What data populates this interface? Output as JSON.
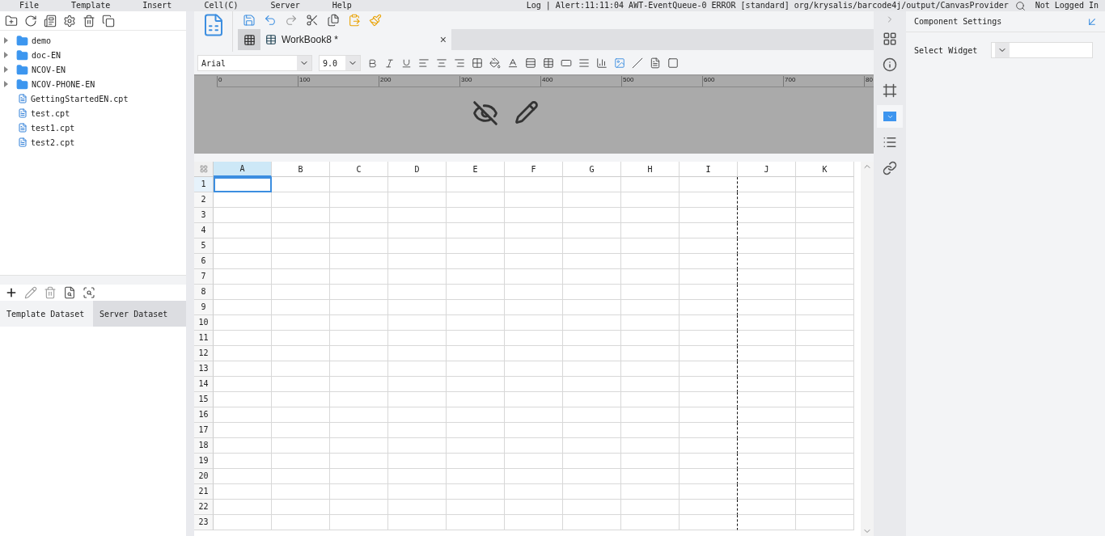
{
  "menu": [
    "File",
    "Template",
    "Insert",
    "Cell(C)",
    "Server",
    "Help"
  ],
  "status_bar": {
    "log": "Log | Alert:11:11:04 AWT-EventQueue-0 ERROR [standard] org/krysalis/barcode4j/output/CanvasProvider",
    "login": "Not Logged In"
  },
  "tree": [
    {
      "kind": "folder",
      "label": "demo"
    },
    {
      "kind": "folder",
      "label": "doc-EN"
    },
    {
      "kind": "folder",
      "label": "NCOV-EN"
    },
    {
      "kind": "folder",
      "label": "NCOV-PHONE-EN"
    },
    {
      "kind": "file",
      "label": "GettingStartedEN.cpt"
    },
    {
      "kind": "file",
      "label": "test.cpt"
    },
    {
      "kind": "file",
      "label": "test1.cpt"
    },
    {
      "kind": "file",
      "label": "test2.cpt"
    }
  ],
  "dataset_tabs": [
    {
      "label": "Template Dataset",
      "selected": true
    },
    {
      "label": "Server Dataset",
      "selected": false
    }
  ],
  "document_tab": {
    "title": "WorkBook8 *",
    "close": "×"
  },
  "format": {
    "font": "Arial",
    "size": "9.0"
  },
  "ruler": [
    "0",
    "100",
    "200",
    "300",
    "400",
    "500",
    "600",
    "700",
    "80"
  ],
  "columns": [
    {
      "label": "A",
      "selected": true,
      "page_break": false
    },
    {
      "label": "B",
      "selected": false,
      "page_break": false
    },
    {
      "label": "C",
      "selected": false,
      "page_break": false
    },
    {
      "label": "D",
      "selected": false,
      "page_break": false
    },
    {
      "label": "E",
      "selected": false,
      "page_break": false
    },
    {
      "label": "F",
      "selected": false,
      "page_break": false
    },
    {
      "label": "G",
      "selected": false,
      "page_break": false
    },
    {
      "label": "H",
      "selected": false,
      "page_break": false
    },
    {
      "label": "I",
      "selected": false,
      "page_break": true
    },
    {
      "label": "J",
      "selected": false,
      "page_break": false
    },
    {
      "label": "K",
      "selected": false,
      "page_break": false
    }
  ],
  "rows": [
    {
      "label": "1",
      "selected": true
    },
    {
      "label": "2",
      "selected": false
    },
    {
      "label": "3",
      "selected": false
    },
    {
      "label": "4",
      "selected": false
    },
    {
      "label": "5",
      "selected": false
    },
    {
      "label": "6",
      "selected": false
    },
    {
      "label": "7",
      "selected": false
    },
    {
      "label": "8",
      "selected": false
    },
    {
      "label": "9",
      "selected": false
    },
    {
      "label": "10",
      "selected": false
    },
    {
      "label": "11",
      "selected": false
    },
    {
      "label": "12",
      "selected": false
    },
    {
      "label": "13",
      "selected": false
    },
    {
      "label": "14",
      "selected": false
    },
    {
      "label": "15",
      "selected": false
    },
    {
      "label": "16",
      "selected": false
    },
    {
      "label": "17",
      "selected": false
    },
    {
      "label": "18",
      "selected": false
    },
    {
      "label": "19",
      "selected": false
    },
    {
      "label": "20",
      "selected": false
    },
    {
      "label": "21",
      "selected": false
    },
    {
      "label": "22",
      "selected": false
    },
    {
      "label": "23",
      "selected": false
    }
  ],
  "rail": [
    {
      "kind": "cell",
      "selected": false
    },
    {
      "kind": "info",
      "selected": false
    },
    {
      "kind": "frame",
      "selected": false
    },
    {
      "kind": "widget",
      "selected": true
    },
    {
      "kind": "list",
      "selected": false
    },
    {
      "kind": "link",
      "selected": false
    }
  ],
  "settings": {
    "title": "Component Settings",
    "widget_label": "Select Widget"
  }
}
